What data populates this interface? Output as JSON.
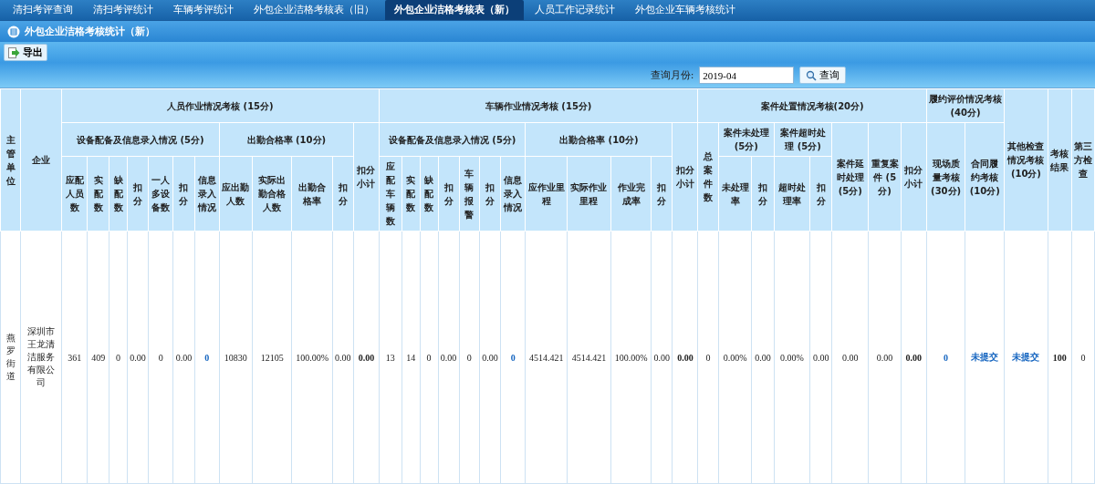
{
  "tabs": [
    {
      "label": "清扫考评查询",
      "selected": false
    },
    {
      "label": "清扫考评统计",
      "selected": false
    },
    {
      "label": "车辆考评统计",
      "selected": false
    },
    {
      "label": "外包企业洁格考核表（旧）",
      "selected": false
    },
    {
      "label": "外包企业洁格考核表（新）",
      "selected": true
    },
    {
      "label": "人员工作记录统计",
      "selected": false
    },
    {
      "label": "外包企业车辆考核统计",
      "selected": false
    }
  ],
  "panel_title": "外包企业洁格考核统计（新）",
  "toolbar": {
    "export_button": "导出"
  },
  "query": {
    "label": "查询月份:",
    "month": "2019-04",
    "button": "查询"
  },
  "table": {
    "headers": [
      {
        "label": "主管单位"
      },
      {
        "label": "企业"
      },
      {
        "label": "人员作业情况考核 (15分)",
        "children": [
          {
            "label": "设备配备及信息录入情况 (5分)",
            "children": [
              {
                "label": "应配人员数"
              },
              {
                "label": "实配数"
              },
              {
                "label": "缺配数"
              },
              {
                "label": "扣分"
              },
              {
                "label": "一人多设备数"
              },
              {
                "label": "扣分"
              },
              {
                "label": "信息录入情况"
              }
            ]
          },
          {
            "label": "出勤合格率 (10分)",
            "children": [
              {
                "label": "应出勤人数"
              },
              {
                "label": "实际出勤合格人数"
              },
              {
                "label": "出勤合格率"
              },
              {
                "label": "扣分"
              }
            ]
          },
          {
            "label": "扣分小计"
          }
        ]
      },
      {
        "label": "车辆作业情况考核 (15分)",
        "children": [
          {
            "label": "设备配备及信息录入情况 (5分)",
            "children": [
              {
                "label": "应配车辆数"
              },
              {
                "label": "实配数"
              },
              {
                "label": "缺配数"
              },
              {
                "label": "扣分"
              },
              {
                "label": "车辆报警"
              },
              {
                "label": "扣分"
              },
              {
                "label": "信息录入情况"
              }
            ]
          },
          {
            "label": "出勤合格率 (10分)",
            "children": [
              {
                "label": "应作业里程"
              },
              {
                "label": "实际作业里程"
              },
              {
                "label": "作业完成率"
              },
              {
                "label": "扣分"
              }
            ]
          },
          {
            "label": "扣分小计"
          }
        ]
      },
      {
        "label": "案件处置情况考核(20分)",
        "children": [
          {
            "label": "总案件数"
          },
          {
            "label": "案件未处理 (5分)",
            "children": [
              {
                "label": "未处理率"
              },
              {
                "label": "扣分"
              }
            ]
          },
          {
            "label": "案件超时处理 (5分)",
            "children": [
              {
                "label": "超时处理率"
              },
              {
                "label": "扣分"
              }
            ]
          },
          {
            "label": "案件延时处理 (5分)"
          },
          {
            "label": "重复案件 (5分)"
          },
          {
            "label": "扣分小计"
          }
        ]
      },
      {
        "label": "履约评价情况考核 (40分)",
        "children": [
          {
            "label": "现场质量考核 (30分)"
          },
          {
            "label": "合同履约考核 (10分)"
          }
        ]
      },
      {
        "label": "其他检查情况考核 (10分)"
      },
      {
        "label": "考核结果"
      },
      {
        "label": "第三方检查"
      }
    ],
    "rows": [
      {
        "cells": [
          {
            "text": "燕罗街道",
            "kind": "text"
          },
          {
            "text": "深圳市王龙清洁服务有限公司",
            "kind": "text"
          },
          {
            "text": "361",
            "kind": "text"
          },
          {
            "text": "409",
            "kind": "text"
          },
          {
            "text": "0",
            "kind": "text"
          },
          {
            "text": "0.00",
            "kind": "text"
          },
          {
            "text": "0",
            "kind": "text"
          },
          {
            "text": "0.00",
            "kind": "text"
          },
          {
            "text": "0",
            "kind": "link"
          },
          {
            "text": "10830",
            "kind": "text"
          },
          {
            "text": "12105",
            "kind": "text"
          },
          {
            "text": "100.00%",
            "kind": "text"
          },
          {
            "text": "0.00",
            "kind": "text"
          },
          {
            "text": "0.00",
            "kind": "bold"
          },
          {
            "text": "13",
            "kind": "text"
          },
          {
            "text": "14",
            "kind": "text"
          },
          {
            "text": "0",
            "kind": "text"
          },
          {
            "text": "0.00",
            "kind": "text"
          },
          {
            "text": "0",
            "kind": "text"
          },
          {
            "text": "0.00",
            "kind": "text"
          },
          {
            "text": "0",
            "kind": "link"
          },
          {
            "text": "4514.421",
            "kind": "text"
          },
          {
            "text": "4514.421",
            "kind": "text"
          },
          {
            "text": "100.00%",
            "kind": "text"
          },
          {
            "text": "0.00",
            "kind": "text"
          },
          {
            "text": "0.00",
            "kind": "bold"
          },
          {
            "text": "0",
            "kind": "text"
          },
          {
            "text": "0.00%",
            "kind": "text"
          },
          {
            "text": "0.00",
            "kind": "text"
          },
          {
            "text": "0.00%",
            "kind": "text"
          },
          {
            "text": "0.00",
            "kind": "text"
          },
          {
            "text": "0.00",
            "kind": "text"
          },
          {
            "text": "0.00",
            "kind": "text"
          },
          {
            "text": "0.00",
            "kind": "bold"
          },
          {
            "text": "0",
            "kind": "link"
          },
          {
            "text": "未提交",
            "kind": "boldlink"
          },
          {
            "text": "未提交",
            "kind": "boldlink"
          },
          {
            "text": "100",
            "kind": "bold"
          },
          {
            "text": "0",
            "kind": "text"
          }
        ]
      }
    ]
  }
}
